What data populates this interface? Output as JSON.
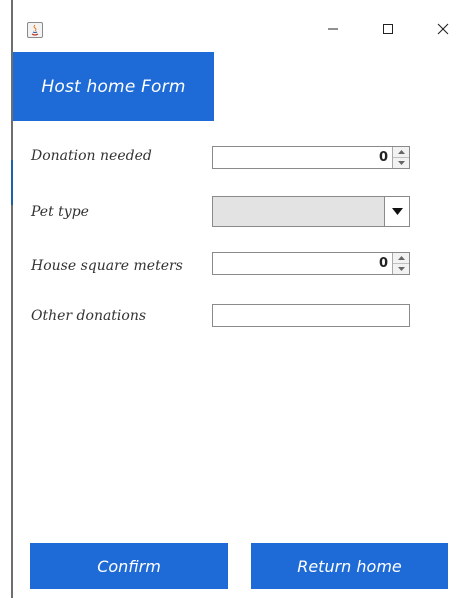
{
  "window": {
    "controls": {
      "minimize_icon": "minimize-icon",
      "maximize_icon": "maximize-icon",
      "close_icon": "close-icon"
    }
  },
  "header": {
    "title": "Host home Form"
  },
  "form": {
    "donation_needed": {
      "label": "Donation needed",
      "value": "0"
    },
    "pet_type": {
      "label": "Pet type",
      "value": ""
    },
    "house_square_meters": {
      "label": "House square meters",
      "value": "0"
    },
    "other_donations": {
      "label": "Other donations",
      "value": ""
    }
  },
  "actions": {
    "confirm_label": "Confirm",
    "return_label": "Return home"
  },
  "colors": {
    "accent": "#1e6ad6",
    "text": "#333333"
  }
}
